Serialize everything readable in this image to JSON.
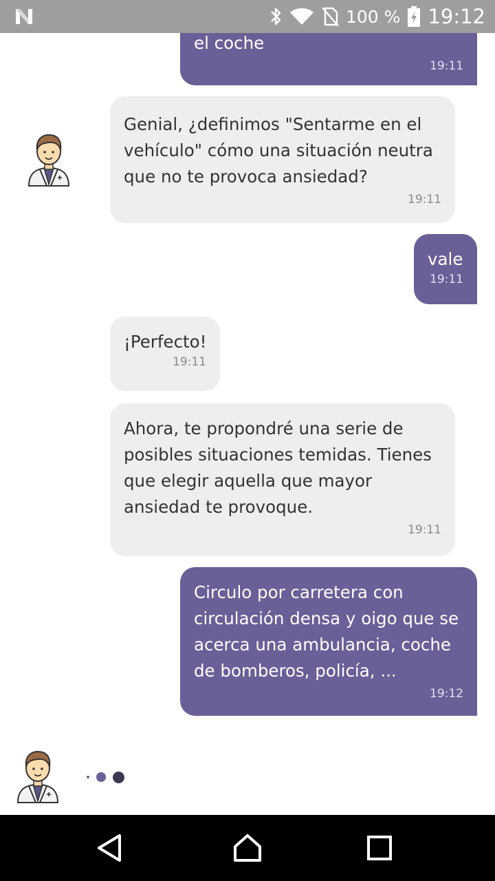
{
  "status_bar": {
    "battery_percent": "100 %",
    "time": "19:12",
    "icons": [
      "notification-n-icon",
      "bluetooth-icon",
      "wifi-icon",
      "no-sim-icon",
      "battery-charging-icon"
    ]
  },
  "colors": {
    "outgoing_bubble": "#6a5f97",
    "incoming_bubble": "#eeeeee",
    "status_bar": "#9e9e9e",
    "nav_bar": "#000000"
  },
  "messages": [
    {
      "direction": "outgoing",
      "text": "el coche",
      "time": "19:11"
    },
    {
      "direction": "incoming",
      "text": "Genial, ¿definimos \"Sentarme en el\nvehículo\" cómo una situación neutra\nque no te provoca ansiedad?",
      "time": "19:11"
    },
    {
      "direction": "outgoing",
      "text": "vale",
      "time": "19:11"
    },
    {
      "direction": "incoming",
      "text": "¡Perfecto!",
      "time": "19:11"
    },
    {
      "direction": "incoming",
      "text": "Ahora, te propondré una serie de\nposibles situaciones temidas.  Tienes\nque elegir aquella que mayor\nansiedad te provoque.",
      "time": "19:11"
    },
    {
      "direction": "outgoing",
      "text": "Circulo por carretera con\ncirculación densa y oigo que se\nacerca una ambulancia, coche\nde bomberos, policía, ...",
      "time": "19:12"
    }
  ],
  "typing_indicator": {
    "visible": true
  },
  "nav": [
    "back-icon",
    "home-icon",
    "recents-icon"
  ]
}
